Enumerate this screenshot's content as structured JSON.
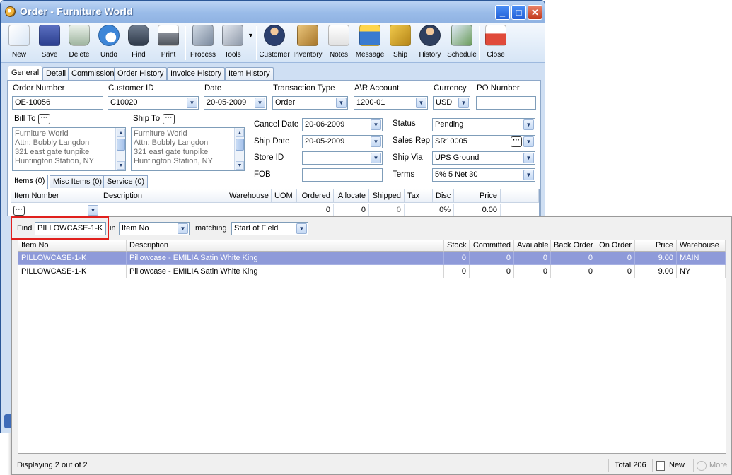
{
  "window": {
    "title": "Order - Furniture World",
    "min": "_",
    "max": "□",
    "close": "✕"
  },
  "toolbar": {
    "new": "New",
    "save": "Save",
    "delete": "Delete",
    "undo": "Undo",
    "find": "Find",
    "print": "Print",
    "process": "Process",
    "tools": "Tools",
    "customer": "Customer",
    "inventory": "Inventory",
    "notes": "Notes",
    "message": "Message",
    "ship": "Ship",
    "history": "History",
    "schedule": "Schedule",
    "close": "Close",
    "tools_arrow": "▼"
  },
  "tabs": {
    "general": "General",
    "detail": "Detail",
    "commission": "Commission",
    "order_history": "Order History",
    "invoice_history": "Invoice History",
    "item_history": "Item History"
  },
  "header": {
    "order_number_label": "Order Number",
    "order_number": "OE-10056",
    "customer_id_label": "Customer ID",
    "customer_id": "C10020",
    "date_label": "Date",
    "date": "20-05-2009",
    "transaction_type_label": "Transaction Type",
    "transaction_type": "Order",
    "ar_account_label": "A\\R Account",
    "ar_account": "1200-01",
    "currency_label": "Currency",
    "currency": "USD",
    "po_number_label": "PO Number",
    "po_number": ""
  },
  "bill_to": {
    "label": "Bill To",
    "ellipsis": "···",
    "lines": [
      "Furniture World",
      "Attn: Bobbly Langdon",
      "321 east gate tunpike",
      "Huntington Station, NY"
    ]
  },
  "ship_to": {
    "label": "Ship To",
    "ellipsis": "···",
    "lines": [
      "Furniture World",
      "Attn: Bobbly Langdon",
      "321 east gate tunpike",
      "Huntington Station, NY"
    ]
  },
  "details": {
    "cancel_date_label": "Cancel  Date",
    "cancel_date": "20-06-2009",
    "ship_date_label": "Ship Date",
    "ship_date": "20-05-2009",
    "store_id_label": "Store ID",
    "store_id": "",
    "fob_label": "FOB",
    "fob": "",
    "status_label": "Status",
    "status": "Pending",
    "sales_rep_label": "Sales Rep",
    "sales_rep": "SR10005",
    "ship_via_label": "Ship Via",
    "ship_via": "UPS Ground",
    "terms_label": "Terms",
    "terms": "5% 5 Net 30"
  },
  "sub_tabs": {
    "items": "Items (0)",
    "misc_items": "Misc Items (0)",
    "service": "Service (0)"
  },
  "items_grid": {
    "columns": [
      "Item Number",
      "Description",
      "Warehouse",
      "UOM",
      "Ordered",
      "Allocate",
      "Shipped",
      "Tax",
      "Disc",
      "Price"
    ],
    "new_row": {
      "ordered": "0",
      "allocate": "0",
      "shipped": "0",
      "disc": "0%",
      "price": "0.00"
    }
  },
  "lookup": {
    "find_label": "Find",
    "find_value": "PILLOWCASE-1-K",
    "in_label": "in",
    "in_value": "Item No",
    "matching_label": "matching",
    "matching_value": "Start of Field",
    "columns": [
      "Item No",
      "Description",
      "Stock",
      "Committed",
      "Available",
      "Back Order",
      "On Order",
      "Price",
      "Warehouse"
    ],
    "rows": [
      {
        "item_no": "PILLOWCASE-1-K",
        "description": "Pillowcase - EMILIA Satin White King",
        "stock": "0",
        "committed": "0",
        "available": "0",
        "back_order": "0",
        "on_order": "0",
        "price": "9.00",
        "warehouse": "MAIN"
      },
      {
        "item_no": "PILLOWCASE-1-K",
        "description": "Pillowcase - EMILIA Satin White King",
        "stock": "0",
        "committed": "0",
        "available": "0",
        "back_order": "0",
        "on_order": "0",
        "price": "9.00",
        "warehouse": "NY"
      }
    ],
    "status_text": "Displaying 2 out of 2",
    "total_text": "Total 206",
    "new_label": "New",
    "more_label": "More"
  },
  "colors": {
    "title_bar": "#99bbe8",
    "selected_row": "#8e9ad9",
    "highlight_box": "#e0201d"
  }
}
